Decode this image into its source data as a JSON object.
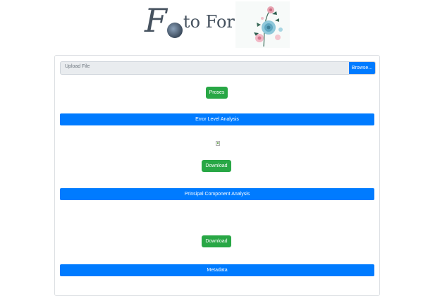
{
  "logo": {
    "initial": "F",
    "text_after": "to Forensi"
  },
  "upload": {
    "placeholder": "Upload File",
    "browse_label": "Browse..."
  },
  "buttons": {
    "process_label": "Proses",
    "download_label": "Download"
  },
  "sections": {
    "ela_title": "Error Level Analysis",
    "pca_title": "Prinsipal Component Analysis",
    "metadata_title": "Metadata"
  },
  "colors": {
    "primary": "#007bff",
    "success": "#28a745",
    "logo_text": "#46525f"
  }
}
